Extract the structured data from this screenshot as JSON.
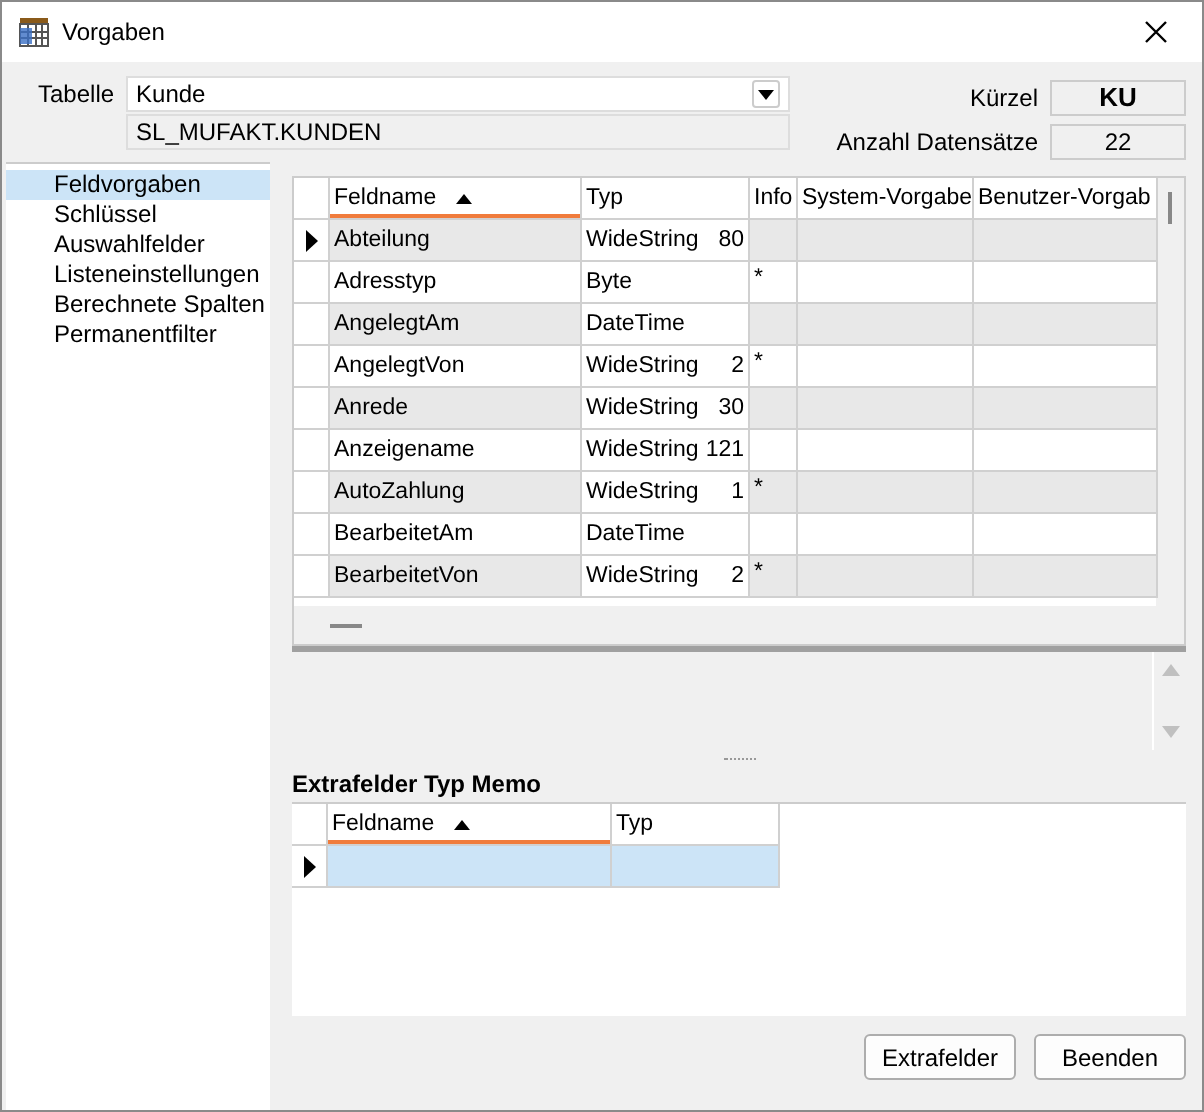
{
  "window": {
    "title": "Vorgaben"
  },
  "tabelle": {
    "label": "Tabelle",
    "value": "Kunde",
    "table_name": "SL_MUFAKT.KUNDEN"
  },
  "kuerzel": {
    "label": "Kürzel",
    "value": "KU"
  },
  "anzahl": {
    "label": "Anzahl Datensätze",
    "value": "22"
  },
  "sidebar": {
    "items": [
      {
        "label": "Feldvorgaben",
        "selected": true
      },
      {
        "label": "Schlüssel",
        "selected": false
      },
      {
        "label": "Auswahlfelder",
        "selected": false
      },
      {
        "label": "Listeneinstellungen",
        "selected": false
      },
      {
        "label": "Berechnete Spalten",
        "selected": false
      },
      {
        "label": "Permanentfilter",
        "selected": false
      }
    ]
  },
  "fields_table": {
    "columns": [
      {
        "label": "Feldname",
        "sorted": true
      },
      {
        "label": "Typ",
        "sorted": false
      },
      {
        "label": "Info",
        "sorted": false
      },
      {
        "label": "System-Vorgabe",
        "sorted": false
      },
      {
        "label": "Benutzer-Vorgab",
        "sorted": false
      }
    ],
    "rows": [
      {
        "name": "Abteilung",
        "type": "WideString",
        "size": "80",
        "info": "",
        "current": true
      },
      {
        "name": "Adresstyp",
        "type": "Byte",
        "size": "",
        "info": "*",
        "current": false
      },
      {
        "name": "AngelegtAm",
        "type": "DateTime",
        "size": "",
        "info": "",
        "current": false
      },
      {
        "name": "AngelegtVon",
        "type": "WideString",
        "size": "2",
        "info": "*",
        "current": false
      },
      {
        "name": "Anrede",
        "type": "WideString",
        "size": "30",
        "info": "",
        "current": false
      },
      {
        "name": "Anzeigename",
        "type": "WideString",
        "size": "121",
        "info": "",
        "current": false
      },
      {
        "name": "AutoZahlung",
        "type": "WideString",
        "size": "1",
        "info": "*",
        "current": false
      },
      {
        "name": "BearbeitetAm",
        "type": "DateTime",
        "size": "",
        "info": "",
        "current": false
      },
      {
        "name": "BearbeitetVon",
        "type": "WideString",
        "size": "2",
        "info": "*",
        "current": false
      }
    ]
  },
  "memo": {
    "title": "Extrafelder Typ Memo",
    "columns": [
      {
        "label": "Feldname",
        "sorted": true
      },
      {
        "label": "Typ",
        "sorted": false
      }
    ],
    "rows": [
      {
        "current": true
      }
    ]
  },
  "buttons": [
    "Extrafelder",
    "Beenden"
  ]
}
